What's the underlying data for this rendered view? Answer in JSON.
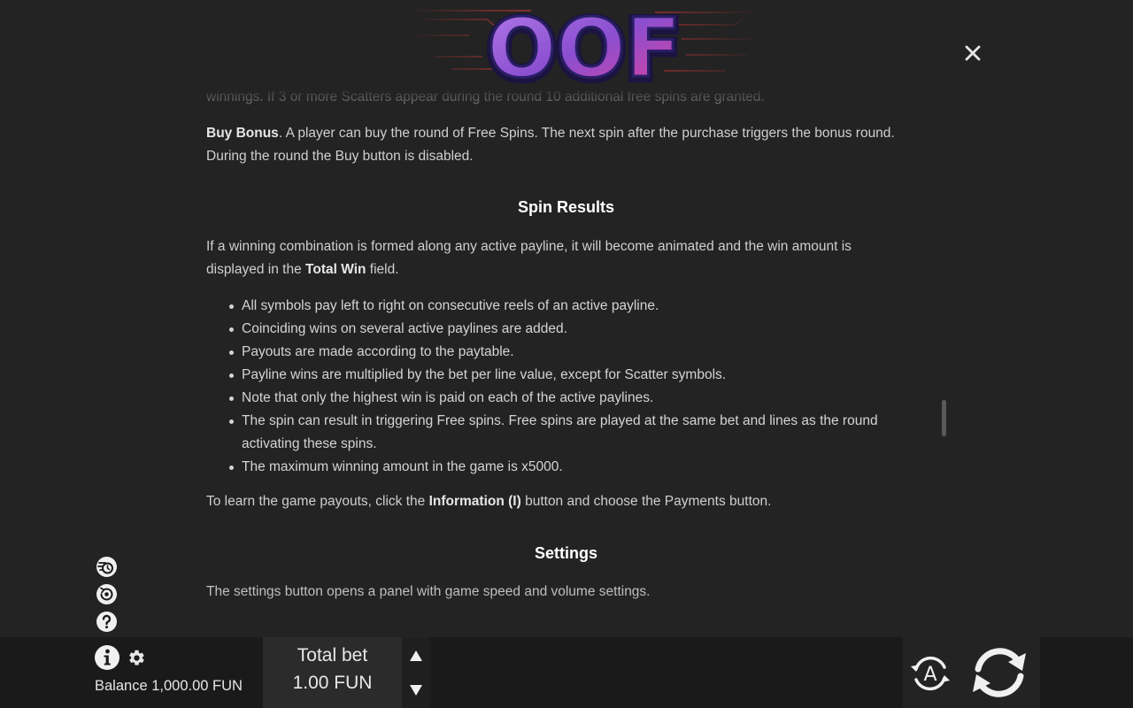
{
  "header": {
    "logo_text": "OOF",
    "close_glyph": "✕"
  },
  "rules": {
    "intro_partial": "winnings. If 3 or more Scatters appear during the round 10 additional free spins are granted.",
    "buy_bonus": {
      "term": "Buy Bonus",
      "text": ". A player can buy the round of Free Spins. The next spin after the purchase triggers the bonus round. During the round the Buy button is disabled."
    },
    "spin_results": {
      "heading": "Spin Results",
      "intro_before": "If a winning combination is formed along any active payline, it will become animated and the win amount is displayed in the ",
      "intro_term": "Total Win",
      "intro_after": " field.",
      "items": [
        "All symbols pay left to right on consecutive reels of an active payline.",
        "Coinciding wins on several active paylines are added.",
        "Payouts are made according to the paytable.",
        "Payline wins are multiplied by the bet per line value, except for Scatter symbols.",
        "Note that only the highest win is paid on each of the active paylines.",
        "The spin can result in triggering Free spins. Free spins are played at the same bet and lines as the round activating these spins.",
        "The maximum winning amount in the game is x5000."
      ],
      "payouts_before": "To learn the game payouts, click the ",
      "payouts_term": "Information (I)",
      "payouts_after": " button and choose the Payments button."
    },
    "settings": {
      "heading": "Settings",
      "text": "The settings button opens a panel with game speed and volume settings."
    }
  },
  "side_icons": [
    "turbo-icon",
    "history-icon",
    "help-icon"
  ],
  "bottom_bar": {
    "balance": "Balance 1,000.00 FUN",
    "total_bet_label": "Total bet",
    "total_bet_value": "1.00 FUN",
    "auto_label": "A"
  },
  "colors": {
    "background": "#232323",
    "bar": "#1a1a1a",
    "logo_purple": "#8a4fd0",
    "logo_pink": "#e0409a"
  }
}
